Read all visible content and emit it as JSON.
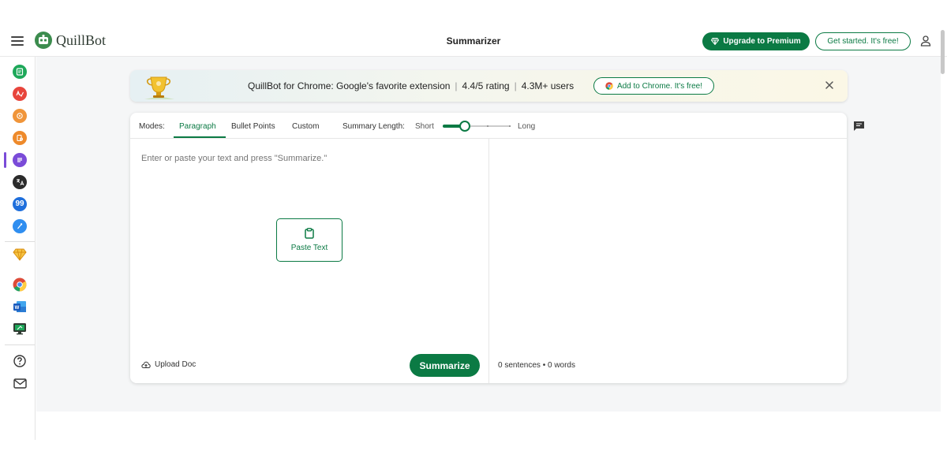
{
  "header": {
    "brand": "QuillBot",
    "title": "Summarizer",
    "upgrade_label": "Upgrade to Premium",
    "get_started_label": "Get started. It's free!"
  },
  "sidebar": {
    "items": [
      {
        "icon": "paraphraser-icon",
        "color": "#1ea85a"
      },
      {
        "icon": "grammar-checker-icon",
        "color": "#e8453c"
      },
      {
        "icon": "ai-detector-icon",
        "color": "#f0953a"
      },
      {
        "icon": "plagiarism-checker-icon",
        "color": "#ee8a2b"
      },
      {
        "icon": "summarizer-icon",
        "color": "#7a4bd8",
        "active": true
      },
      {
        "icon": "translator-icon",
        "color": "#2b2b2b"
      },
      {
        "icon": "citation-generator-icon",
        "color": "#1f6fdc"
      },
      {
        "icon": "quillbot-flow-icon",
        "color": "#2f8ef0"
      },
      {
        "icon": "premium-diamond-icon",
        "color": "#e9a825"
      },
      {
        "icon": "chrome-extension-icon",
        "color": "#dd4b39"
      },
      {
        "icon": "word-addin-icon",
        "color": "#2b5797"
      },
      {
        "icon": "desktop-app-icon",
        "color": "#1ea85a"
      },
      {
        "icon": "help-icon",
        "color": "#333333"
      },
      {
        "icon": "mail-icon",
        "color": "#333333"
      }
    ]
  },
  "banner": {
    "text_main": "QuillBot for Chrome: Google's favorite extension",
    "text_rating": "4.4/5 rating",
    "text_users": "4.3M+ users",
    "cta_label": "Add to Chrome. It's free!"
  },
  "modes": {
    "label": "Modes:",
    "tabs": [
      {
        "label": "Paragraph",
        "active": true
      },
      {
        "label": "Bullet Points",
        "active": false
      },
      {
        "label": "Custom",
        "active": false
      }
    ],
    "summary_length_label": "Summary Length:",
    "short_label": "Short",
    "long_label": "Long",
    "summary_length_value": 0.33
  },
  "input": {
    "placeholder": "Enter or paste your text and press \"Summarize.\"",
    "paste_label": "Paste Text",
    "upload_label": "Upload Doc",
    "summarize_label": "Summarize"
  },
  "output": {
    "stats": "0 sentences • 0 words"
  },
  "colors": {
    "brand_green": "#0b7a44",
    "accent_purple": "#7a4bd8"
  }
}
